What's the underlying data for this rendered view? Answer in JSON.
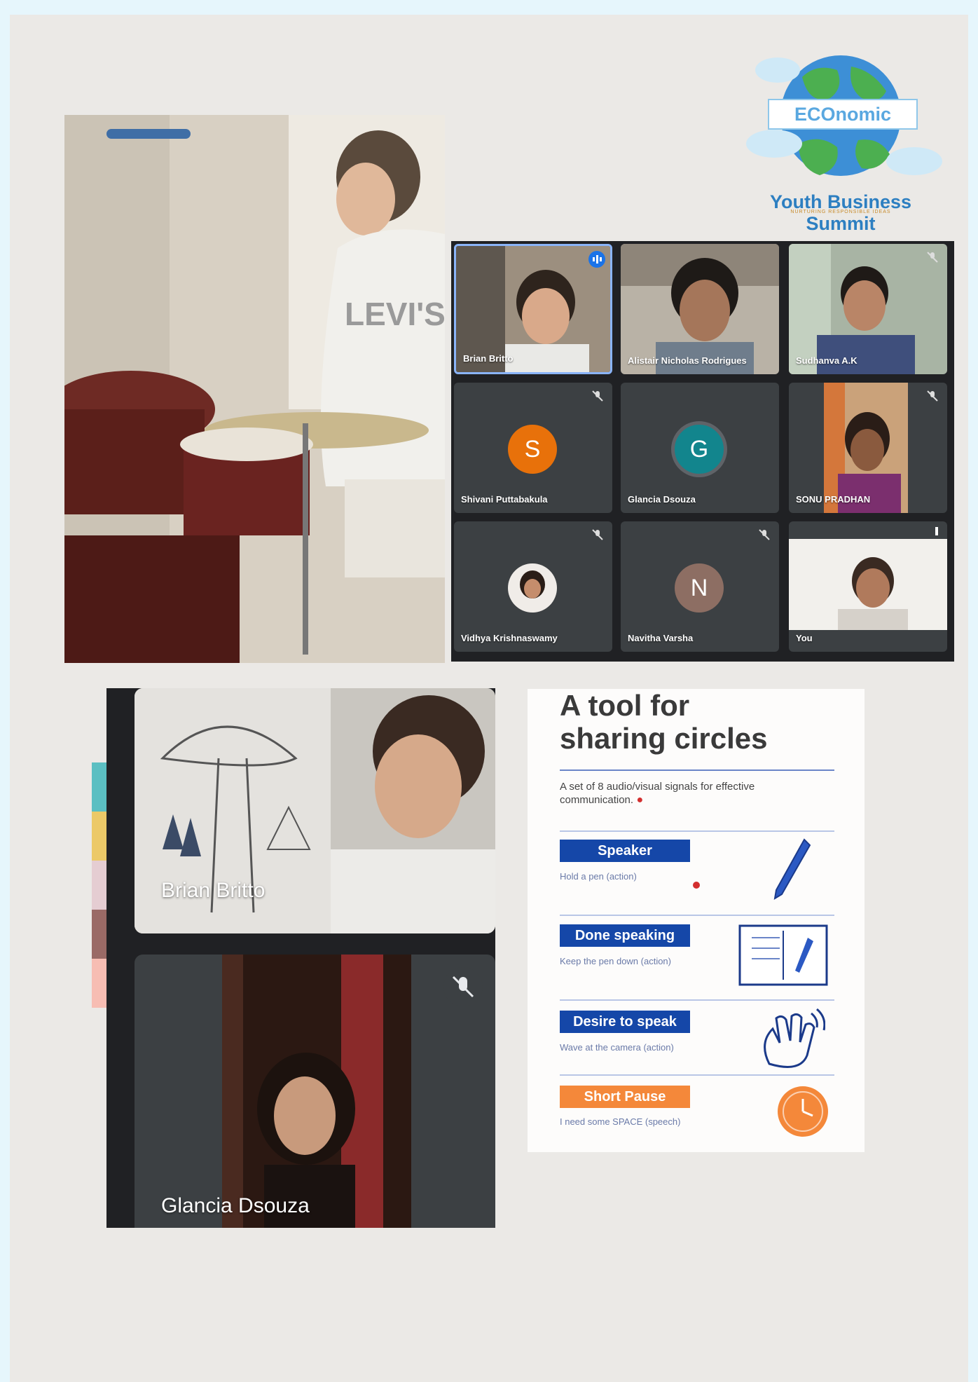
{
  "logo": {
    "band_text": "ECOnomic",
    "title": "Youth Business Summit",
    "subtitle": "NURTURING RESPONSIBLE IDEAS",
    "brand_color": "#2d7fc1"
  },
  "drum_photo": {
    "shirt_text": "LEVI'S"
  },
  "meet": {
    "tiles": [
      {
        "name": "Brian Britto",
        "type": "video",
        "speaking": true
      },
      {
        "name": "Alistair Nicholas Rodrigues",
        "type": "video"
      },
      {
        "name": "Sudhanva A.K",
        "type": "video",
        "muted": true
      },
      {
        "name": "Shivani Puttabakula",
        "type": "avatar",
        "initial": "S",
        "color": "#e8710a",
        "muted": true
      },
      {
        "name": "Glancia Dsouza",
        "type": "avatar",
        "initial": "G",
        "color": "#12858d"
      },
      {
        "name": "SONU PRADHAN",
        "type": "video",
        "muted": true
      },
      {
        "name": "Vidhya Krishnaswamy",
        "type": "photo",
        "muted": true
      },
      {
        "name": "Navitha Varsha",
        "type": "avatar",
        "initial": "N",
        "color": "#8d6e63",
        "muted": true
      },
      {
        "name": "You",
        "type": "video"
      }
    ]
  },
  "call": {
    "top_name": "Brian Britto",
    "bottom_name": "Glancia Dsouza"
  },
  "swatches": [
    "#5bbfc2",
    "#ecc968",
    "#e5cdd2",
    "#9a6a66",
    "#f7bdb3"
  ],
  "card": {
    "title_line1": "A tool for",
    "title_line2": "sharing circles",
    "intro": "A set of 8 audio/visual signals for effective communication.",
    "signals": [
      {
        "label": "Speaker",
        "note": "Hold a pen (action)",
        "color": "#1547a8",
        "icon": "pen-icon"
      },
      {
        "label": "Done speaking",
        "note": "Keep the pen down (action)",
        "color": "#1547a8",
        "icon": "notebook-pen-icon"
      },
      {
        "label": "Desire to speak",
        "note": "Wave at the camera (action)",
        "color": "#1547a8",
        "icon": "waving-hand-icon"
      },
      {
        "label": "Short Pause",
        "note": "I need some SPACE (speech)",
        "color": "#f4883a",
        "icon": "clock-icon"
      }
    ]
  }
}
